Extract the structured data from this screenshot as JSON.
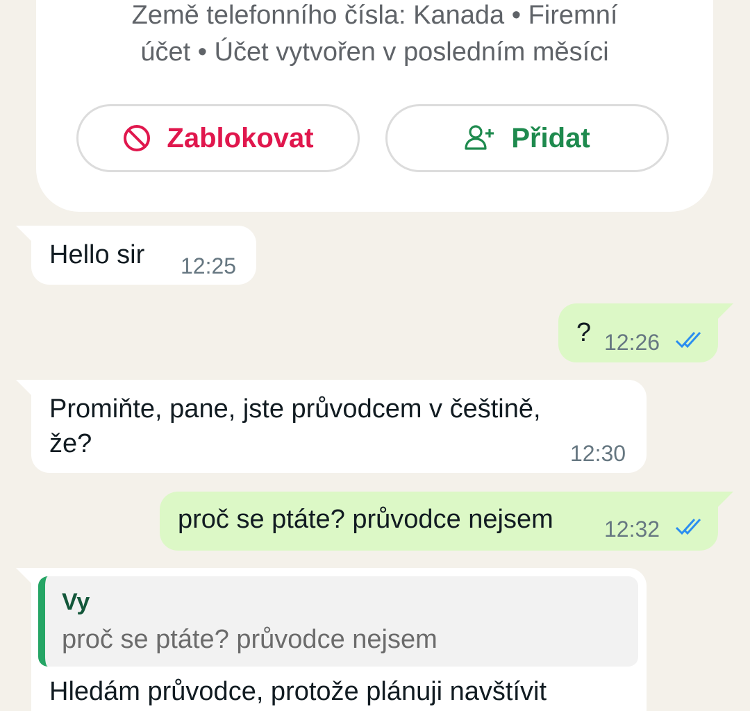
{
  "contact_info": {
    "line1": "Země telefonního čísla: Kanada • Firemní",
    "line2": "účet • Účet vytvořen v posledním měsíci",
    "block_label": "Zablokovat",
    "add_label": "Přidat",
    "block_color": "#e0174d",
    "add_color": "#1e8a4e"
  },
  "messages": [
    {
      "direction": "incoming",
      "text": "Hello sir",
      "time": "12:25"
    },
    {
      "direction": "outgoing",
      "text": "?",
      "time": "12:26",
      "status": "read"
    },
    {
      "direction": "incoming",
      "text_line1": "Promiňte, pane, jste průvodcem v češtině,",
      "text_line2": "že?",
      "time": "12:30"
    },
    {
      "direction": "outgoing",
      "text": "proč se ptáte? průvodce nejsem",
      "time": "12:32",
      "status": "read"
    },
    {
      "direction": "incoming",
      "quote_author": "Vy",
      "quote_text": "proč se ptáte? průvodce nejsem",
      "text": "Hledám průvodce, protože plánuji navštívit"
    }
  ]
}
